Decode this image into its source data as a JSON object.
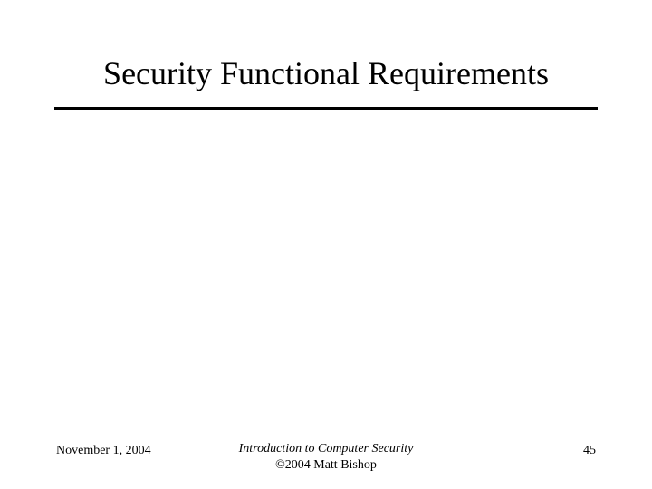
{
  "slide": {
    "title": "Security Functional Requirements"
  },
  "footer": {
    "date": "November 1, 2004",
    "book_title": "Introduction to Computer Security",
    "copyright": "©2004 Matt Bishop",
    "page_number": "45"
  }
}
